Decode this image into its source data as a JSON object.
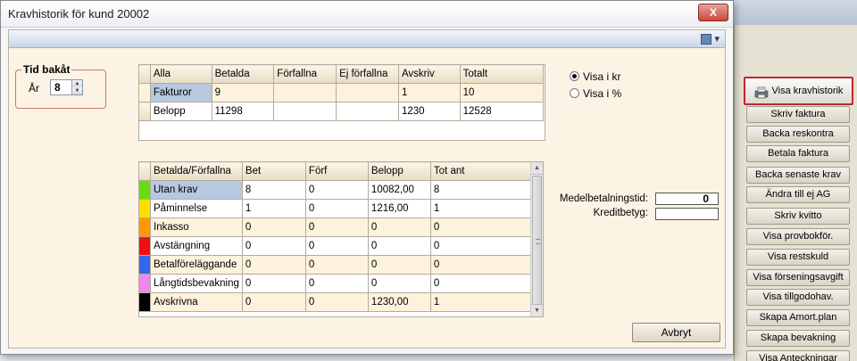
{
  "dialog": {
    "title": "Kravhistorik för kund 20002",
    "close_label": "X"
  },
  "tid_bakat": {
    "legend": "Tid bakåt",
    "label": "År",
    "value": "8"
  },
  "summary_table": {
    "headers": [
      "Alla",
      "Betalda",
      "Förfallna",
      "Ej förfallna",
      "Avskriv",
      "Totalt"
    ],
    "rows": [
      {
        "label": "Fakturor",
        "cells": [
          "9",
          "",
          "",
          "1",
          "10"
        ]
      },
      {
        "label": "Belopp",
        "cells": [
          "11298",
          "",
          "",
          "1230",
          "12528"
        ]
      }
    ]
  },
  "radio": {
    "kr": "Visa i kr",
    "pct": "Visa i %",
    "selected": "kr"
  },
  "detail_table": {
    "headers": [
      "Betalda/Förfallna",
      "Bet",
      "Förf",
      "Belopp",
      "Tot ant"
    ],
    "rows": [
      {
        "color": "#66dd11",
        "label": "Utan krav",
        "cells": [
          "8",
          "0",
          "10082,00",
          "8"
        ]
      },
      {
        "color": "#ffdd00",
        "label": "Påminnelse",
        "cells": [
          "1",
          "0",
          "1216,00",
          "1"
        ]
      },
      {
        "color": "#ff9900",
        "label": "Inkasso",
        "cells": [
          "0",
          "0",
          "0",
          "0"
        ]
      },
      {
        "color": "#ee1111",
        "label": "Avstängning",
        "cells": [
          "0",
          "0",
          "0",
          "0"
        ]
      },
      {
        "color": "#3366ee",
        "label": "Betalföreläggande",
        "cells": [
          "0",
          "0",
          "0",
          "0"
        ]
      },
      {
        "color": "#ee88ee",
        "label": "Långtidsbevakning",
        "cells": [
          "0",
          "0",
          "0",
          "0"
        ]
      },
      {
        "color": "#000000",
        "label": "Avskrivna",
        "cells": [
          "0",
          "0",
          "1230,00",
          "1"
        ]
      }
    ]
  },
  "stats": {
    "medel_label": "Medelbetalningstid:",
    "medel_value": "0",
    "kredit_label": "Kreditbetyg:",
    "kredit_value": ""
  },
  "buttons": {
    "avbryt": "Avbryt"
  },
  "side_buttons": [
    "Visa kravhistorik",
    "Skriv faktura",
    "Backa reskontra",
    "Betala faktura",
    "Backa senaste krav",
    "Ändra till ej AG",
    "Skriv kvitto",
    "Visa provbokför.",
    "Visa restskuld",
    "Visa förseningsavgift",
    "Visa tillgodohav.",
    "Skapa Amort.plan",
    "Skapa bevakning",
    "Visa Anteckningar"
  ]
}
